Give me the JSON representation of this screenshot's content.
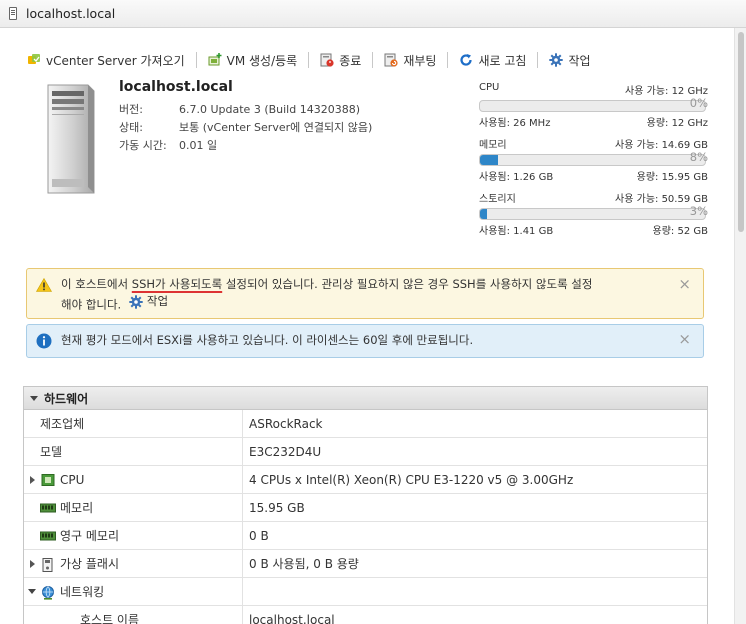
{
  "window": {
    "title": "localhost.local"
  },
  "toolbar": [
    {
      "label": "vCenter Server 가져오기",
      "icon": "vcenter-icon"
    },
    {
      "label": "VM 생성/등록",
      "icon": "create-vm-icon"
    },
    {
      "label": "종료",
      "icon": "shutdown-icon"
    },
    {
      "label": "재부팅",
      "icon": "reboot-icon"
    },
    {
      "label": "새로 고침",
      "icon": "refresh-icon"
    },
    {
      "label": "작업",
      "icon": "gear-icon"
    }
  ],
  "host": {
    "name": "localhost.local",
    "fields": [
      {
        "label": "버전:",
        "value": "6.7.0 Update 3 (Build 14320388)"
      },
      {
        "label": "상태:",
        "value": "보통 (vCenter Server에 연결되지 않음)"
      },
      {
        "label": "가동 시간:",
        "value": "0.01 일"
      }
    ]
  },
  "resources": [
    {
      "name": "CPU",
      "available": "사용 가능: 12 GHz",
      "percent_text": "0%",
      "percent": 0,
      "used": "사용됨: 26 MHz",
      "capacity": "용량: 12 GHz"
    },
    {
      "name": "메모리",
      "available": "사용 가능: 14.69 GB",
      "percent_text": "8%",
      "percent": 8,
      "used": "사용됨: 1.26 GB",
      "capacity": "용량: 15.95 GB"
    },
    {
      "name": "스토리지",
      "available": "사용 가능: 50.59 GB",
      "percent_text": "3%",
      "percent": 3,
      "used": "사용됨: 1.41 GB",
      "capacity": "용량: 52 GB"
    }
  ],
  "alerts": {
    "warning": {
      "pre": "이 호스트에서 ",
      "highlight": "SSH가 사용되도록",
      "post": " 설정되어 있습니다. 관리상 필요하지 않은 경우 SSH를 사용하지 않도록 설정",
      "line2": "해야 합니다.",
      "action": "작업",
      "close": "×"
    },
    "info": {
      "text": "현재 평가 모드에서 ESXi를 사용하고 있습니다. 이 라이센스는 60일 후에 만료됩니다.",
      "close": "×"
    }
  },
  "hardware": {
    "title": "하드웨어",
    "rows": [
      {
        "label": "제조업체",
        "value": "ASRockRack",
        "expandable": false,
        "expanded": false,
        "icon": ""
      },
      {
        "label": "모델",
        "value": "E3C232D4U",
        "expandable": false,
        "expanded": false,
        "icon": ""
      },
      {
        "label": "CPU",
        "value": "4 CPUs x Intel(R) Xeon(R) CPU E3-1220 v5 @ 3.00GHz",
        "expandable": true,
        "expanded": false,
        "icon": "cpu-icon"
      },
      {
        "label": "메모리",
        "value": "15.95 GB",
        "expandable": false,
        "expanded": false,
        "icon": "memory-icon"
      },
      {
        "label": "영구 메모리",
        "value": "0 B",
        "expandable": false,
        "expanded": false,
        "icon": "persistent-memory-icon"
      },
      {
        "label": "가상 플래시",
        "value": "0 B 사용됨, 0 B 용량",
        "expandable": true,
        "expanded": false,
        "icon": "virtual-flash-icon"
      },
      {
        "label": "네트워킹",
        "value": "",
        "expandable": true,
        "expanded": true,
        "icon": "networking-icon"
      },
      {
        "label": "호스트 이름",
        "value": "localhost.local",
        "expandable": false,
        "expanded": false,
        "icon": ""
      }
    ]
  },
  "colors": {
    "bar_fill": "#2e86c8",
    "warning_bg": "#fcf7e1",
    "info_bg": "#e1eff9",
    "ssh_underline": "#dd3333"
  }
}
